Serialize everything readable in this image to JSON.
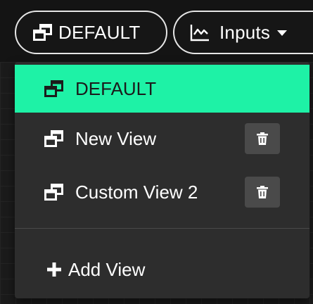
{
  "toolbar": {
    "view_selector": {
      "label": "DEFAULT",
      "icon": "window-stack-icon"
    },
    "inputs_button": {
      "label": "Inputs",
      "icon": "line-chart-icon",
      "dropdown_icon": "caret-down-icon"
    }
  },
  "views_menu": {
    "items": [
      {
        "label": "DEFAULT",
        "selected": true,
        "icon": "window-stack-icon",
        "deletable": false
      },
      {
        "label": "New View",
        "selected": false,
        "icon": "window-stack-icon",
        "deletable": true,
        "delete_icon": "trash-icon"
      },
      {
        "label": "Custom View 2",
        "selected": false,
        "icon": "window-stack-icon",
        "deletable": true,
        "delete_icon": "trash-icon"
      }
    ],
    "add_view": {
      "label": "Add View",
      "icon": "plus-icon"
    }
  },
  "colors": {
    "accent": "#1ef2a6",
    "menu_background": "#2d2d2d",
    "delete_button_background": "#4a4a4a",
    "text": "#ffffff"
  }
}
